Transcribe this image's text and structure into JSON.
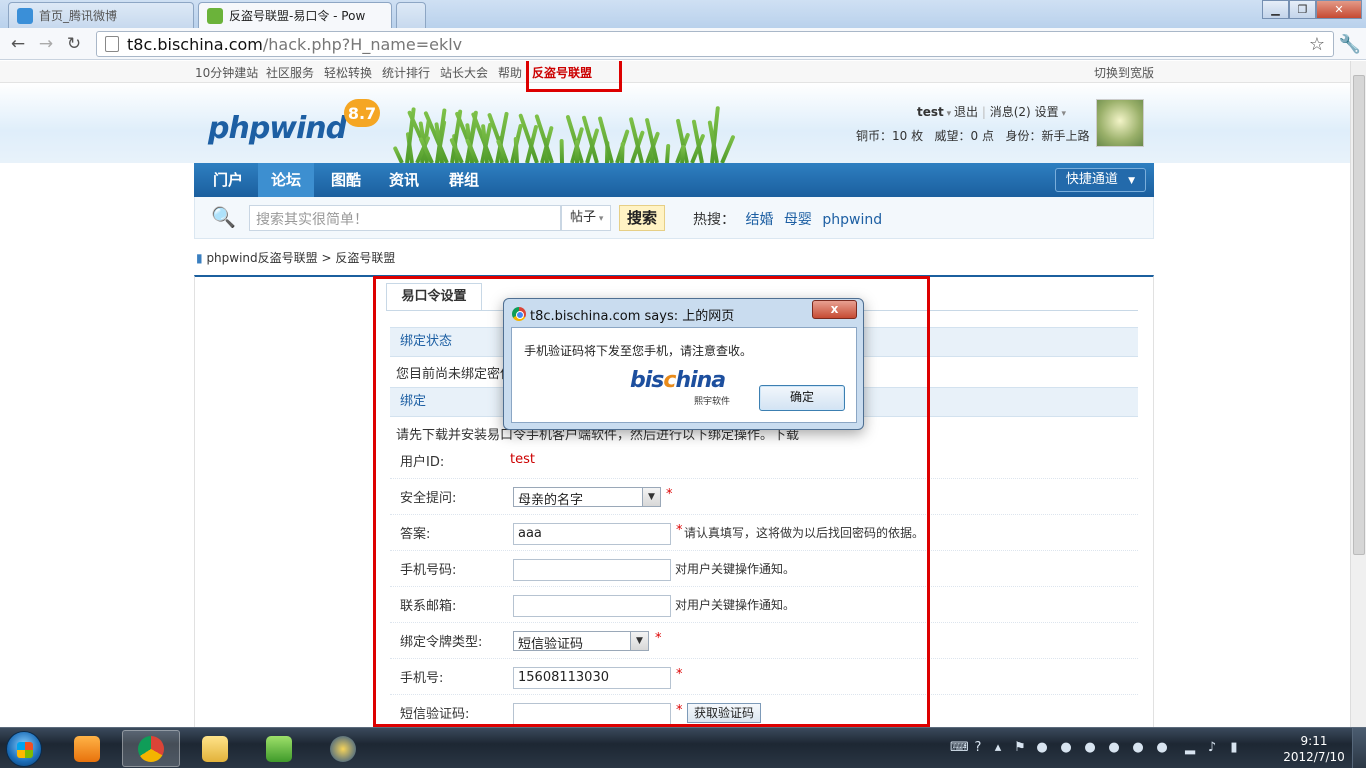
{
  "browser": {
    "tabs": [
      {
        "label": "首页_腾讯微博",
        "active": false
      },
      {
        "label": "反盗号联盟-易口令 - Pow",
        "active": true
      }
    ],
    "url_host": "t8c.bischina.com",
    "url_path": "/hack.php?H_name=eklv"
  },
  "topbar": {
    "links": [
      "10分钟建站",
      "社区服务",
      "轻松转换",
      "统计排行",
      "站长大会",
      "帮助",
      "反盗号联盟"
    ],
    "right_link": "切换到宽版"
  },
  "header": {
    "logo": "phpwind",
    "version": "8.7",
    "user": "test",
    "logout": "退出",
    "messages": "消息(2)",
    "settings": "设置",
    "copper": "铜币：10 枚",
    "prestige": "威望：0 点",
    "identity": "身份：新手上路"
  },
  "mainnav": {
    "items": [
      "门户",
      "论坛",
      "图酷",
      "资讯",
      "群组"
    ],
    "current": "论坛",
    "quick": "快捷通道"
  },
  "search": {
    "placeholder": "搜索其实很简单！",
    "type": "帖子",
    "button": "搜索",
    "hot_label": "热搜：",
    "hot_keywords": [
      "结婚",
      "母婴",
      "phpwind"
    ]
  },
  "breadcrumb": {
    "items": [
      "phpwind反盗号联盟",
      "反盗号联盟"
    ],
    "separator": ">"
  },
  "panel": {
    "tab": "易口令设置",
    "section_status": "绑定状态",
    "status_text": "您目前尚未绑定密保",
    "section_bind": "绑定",
    "instruction": "请先下载并安装易口令手机客户端软件，然后进行以下绑定操作。下载"
  },
  "form": {
    "user_id_label": "用户ID:",
    "user_id_value": "test",
    "question_label": "安全提问:",
    "question_value": "母亲的名字",
    "answer_label": "答案:",
    "answer_value": "aaa",
    "answer_hint": "请认真填写，这将做为以后找回密码的依据。",
    "phone_label": "手机号码:",
    "phone_hint": "对用户关键操作通知。",
    "email_label": "联系邮箱:",
    "email_hint": "对用户关键操作通知。",
    "token_label": "绑定令牌类型:",
    "token_value": "短信验证码",
    "mobile_label": "手机号:",
    "mobile_value": "15608113030",
    "sms_label": "短信验证码:",
    "get_code": "获取验证码",
    "required": "*"
  },
  "dialog": {
    "title": "t8c.bischina.com says: 上的网页",
    "message": "手机验证码将下发至您手机，请注意查收。",
    "brand": "bischina",
    "brand_sub": "熙宇软件",
    "ok": "确定",
    "close": "x"
  },
  "taskbar": {
    "time": "9:11",
    "date": "2012/7/10"
  }
}
